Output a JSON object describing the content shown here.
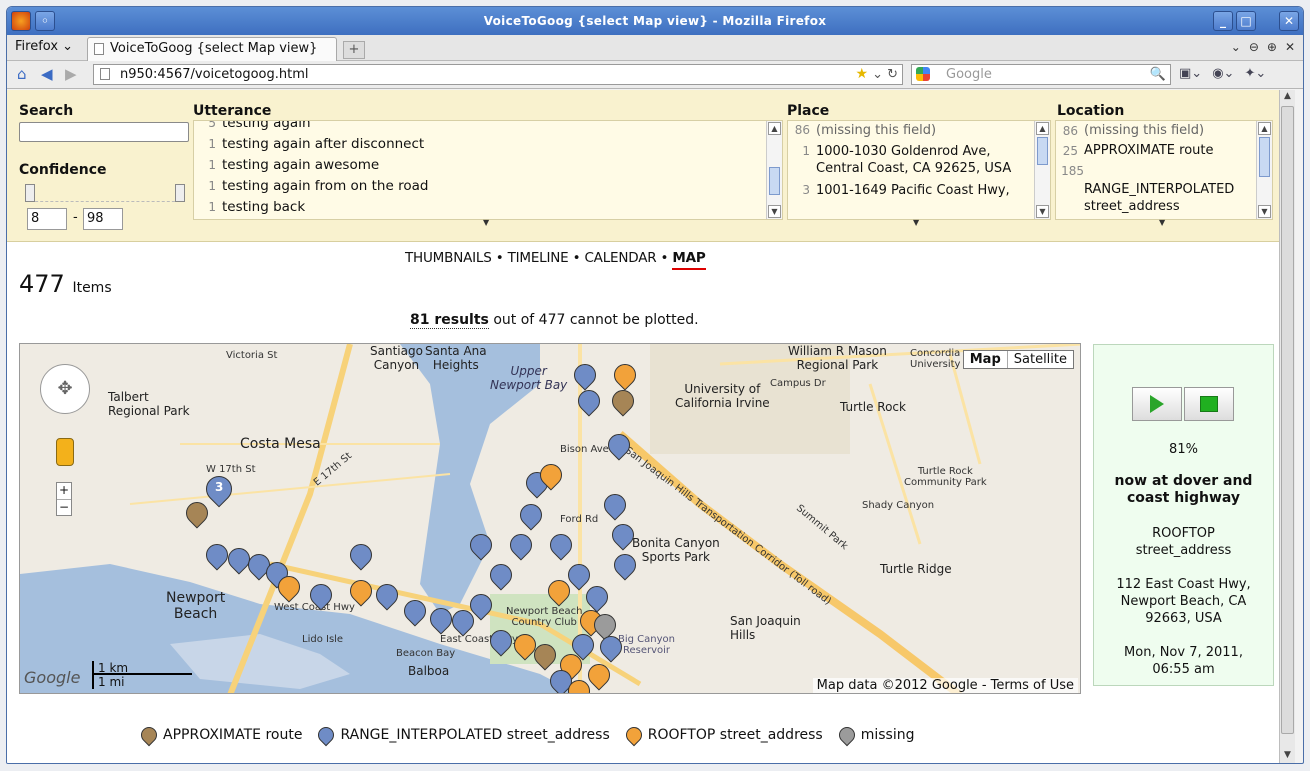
{
  "window": {
    "title": "VoiceToGoog {select Map view} - Mozilla Firefox"
  },
  "tabs": {
    "menu": "Firefox",
    "active_tab": "VoiceToGoog {select Map view}"
  },
  "navbar": {
    "url": "n950:4567/voicetogoog.html",
    "search_placeholder": "Google"
  },
  "facets": {
    "search": {
      "label": "Search"
    },
    "confidence": {
      "label": "Confidence",
      "min": "8",
      "max": "98",
      "dash": "-"
    },
    "utterance": {
      "label": "Utterance",
      "items": [
        {
          "count": "5",
          "text": "testing again"
        },
        {
          "count": "1",
          "text": "testing again after disconnect"
        },
        {
          "count": "1",
          "text": "testing again awesome"
        },
        {
          "count": "1",
          "text": "testing again from on the road"
        },
        {
          "count": "1",
          "text": "testing back"
        }
      ]
    },
    "place": {
      "label": "Place",
      "items": [
        {
          "count": "86",
          "text": "(missing this field)"
        },
        {
          "count": "1",
          "text": "1000-1030 Goldenrod Ave, Central Coast, CA 92625, USA"
        },
        {
          "count": "3",
          "text": "1001-1649 Pacific Coast Hwy,"
        }
      ]
    },
    "location": {
      "label": "Location",
      "items": [
        {
          "count": "86",
          "text": "(missing this field)"
        },
        {
          "count": "25",
          "text": "APPROXIMATE route"
        },
        {
          "count": "185",
          "text": ""
        },
        {
          "count": "",
          "text": "RANGE_INTERPOLATED street_address"
        }
      ]
    }
  },
  "views": {
    "thumbnails": "THUMBNAILS",
    "timeline": "TIMELINE",
    "calendar": "CALENDAR",
    "map": "MAP",
    "sep": "•"
  },
  "summary": {
    "count": "477",
    "items_label": "Items",
    "results_link": "81 results",
    "results_rest": "out of 477 cannot be plotted."
  },
  "map": {
    "type_map": "Map",
    "type_satellite": "Satellite",
    "brand": "Google",
    "scale_km": "1 km",
    "scale_mi": "1 mi",
    "copyright": "Map data ©2012 Google - Terms of Use",
    "labels": {
      "costa_mesa": "Costa Mesa",
      "newport_beach": "Newport\nBeach",
      "upper_newport_bay": "Upper\nNewport Bay",
      "uci": "University of\nCalifornia Irvine",
      "turtle_rock": "Turtle Rock",
      "bonita": "Bonita Canyon\nSports Park",
      "san_joaquin": "San Joaquin\nHills",
      "turtle_ridge": "Turtle Ridge",
      "talbert": "Talbert\nRegional Park",
      "victoria": "Victoria St",
      "santiago": "Santiago\nCanyon",
      "santa_ana": "Santa Ana\nHeights",
      "william_mason": "William R Mason\nRegional Park",
      "concordia": "Concordia\nUniversity",
      "balboa": "Balboa",
      "lido": "Lido Isle",
      "beacon": "Beacon Bay",
      "turtle_rock_park": "Turtle Rock\nCommunity Park",
      "shady": "Shady Canyon",
      "sjh_corridor": "San Joaquin Hills Transportation Corridor (Toll road)",
      "newport_cc": "Newport Beach\nCountry Club",
      "big_canyon": "Big Canyon\nReservoir",
      "ford": "Ford Rd",
      "bison": "Bison Ave",
      "campus": "Campus Dr",
      "summit": "Summit Park",
      "pcoast": "West Coast Hwy",
      "ecoast": "East Coast Hwy",
      "w17": "W 17th St",
      "e17": "E 17th St"
    },
    "cluster_count": "3"
  },
  "player": {
    "percent": "81%",
    "status": "now at dover and coast highway",
    "loc_type": "ROOFTOP",
    "loc_kind": "street_address",
    "address": "112 East Coast Hwy, Newport Beach, CA 92663, USA",
    "time": "Mon, Nov 7, 2011, 06:55 am"
  },
  "legend": [
    {
      "label": "APPROXIMATE route",
      "color": "#a68556"
    },
    {
      "label": "RANGE_INTERPOLATED street_address",
      "color": "#6f8cc6"
    },
    {
      "label": "ROOFTOP street_address",
      "color": "#f2a23a"
    },
    {
      "label": "missing",
      "color": "#9b9b9b"
    }
  ]
}
